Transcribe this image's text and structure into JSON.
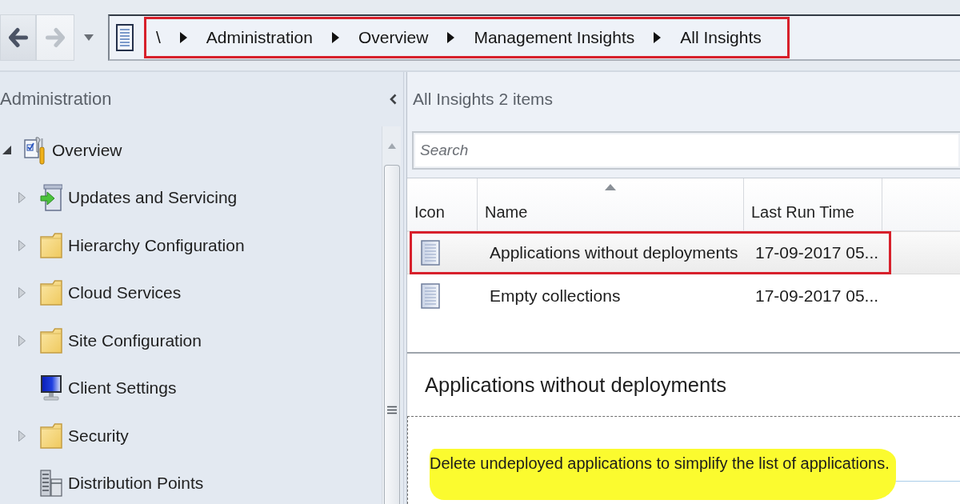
{
  "toolbar": {
    "back_button": {
      "disabled": false
    },
    "forward_button": {
      "disabled": true
    },
    "address_bar": {
      "annotated": true,
      "crumbs": [
        "\\",
        "Administration",
        "Overview",
        "Management Insights",
        "All Insights"
      ]
    }
  },
  "navigation": {
    "title": "Administration",
    "tree": [
      {
        "label": "Overview",
        "kind": "overview",
        "expanded": true,
        "children": [
          {
            "label": "Updates and Servicing",
            "kind": "updates",
            "expanded": false
          },
          {
            "label": "Hierarchy Configuration",
            "kind": "folder",
            "expanded": false
          },
          {
            "label": "Cloud Services",
            "kind": "folder",
            "expanded": false
          },
          {
            "label": "Site Configuration",
            "kind": "folder",
            "expanded": false
          },
          {
            "label": "Client Settings",
            "kind": "monitor"
          },
          {
            "label": "Security",
            "kind": "folder",
            "expanded": false
          },
          {
            "label": "Distribution Points",
            "kind": "servers"
          }
        ]
      }
    ]
  },
  "list_view": {
    "title": "All Insights 2 items",
    "search": {
      "placeholder": "Search"
    },
    "columns": [
      {
        "label": "Icon",
        "sorted": false
      },
      {
        "label": "Name",
        "sorted": true
      },
      {
        "label": "Last Run Time",
        "sorted": false
      }
    ],
    "rows": [
      {
        "name": "Applications without deployments",
        "last_run_time": "17-09-2017 05...",
        "selected": true,
        "annotated": true
      },
      {
        "name": "Empty collections",
        "last_run_time": "17-09-2017 05...",
        "selected": false,
        "annotated": false
      }
    ]
  },
  "details": {
    "title": "Applications without deployments",
    "description": "Delete undeployed applications to simplify the list of applications.",
    "highlighted": true
  }
}
